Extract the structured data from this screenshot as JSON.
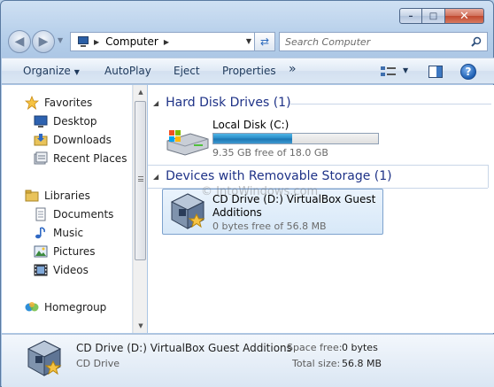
{
  "window": {
    "controls": {
      "minimize": "–",
      "maximize": "□",
      "close": "✕"
    }
  },
  "nav": {
    "address": {
      "segment": "Computer"
    },
    "search": {
      "placeholder": "Search Computer"
    }
  },
  "commands": {
    "organize": "Organize",
    "autoplay": "AutoPlay",
    "eject": "Eject",
    "properties": "Properties",
    "more": "»",
    "help": "?"
  },
  "sidebar": {
    "favorites": "Favorites",
    "desktop": "Desktop",
    "downloads": "Downloads",
    "recent_places": "Recent Places",
    "libraries": "Libraries",
    "documents": "Documents",
    "music": "Music",
    "pictures": "Pictures",
    "videos": "Videos",
    "homegroup": "Homegroup"
  },
  "content": {
    "groups": [
      {
        "header": "Hard Disk Drives (1)"
      },
      {
        "header": "Devices with Removable Storage (1)"
      }
    ],
    "local_disk": {
      "name": "Local Disk (C:)",
      "free_text": "9.35 GB free of 18.0 GB",
      "used_fraction": 0.48
    },
    "cd_drive": {
      "name_line1": "CD Drive (D:) VirtualBox Guest",
      "name_line2": "Additions",
      "free_text": "0 bytes free of 56.8 MB"
    },
    "watermark": "© IntoWindows.com"
  },
  "details": {
    "title": "CD Drive (D:) VirtualBox Guest Additions",
    "type": "CD Drive",
    "space_free_label": "Space free:",
    "space_free_value": "0 bytes",
    "total_size_label": "Total size:",
    "total_size_value": "56.8 MB"
  },
  "colors": {
    "accent_header": "#1e3287",
    "drive_bar": "#2689c5",
    "selection": "#d7e8f8"
  }
}
